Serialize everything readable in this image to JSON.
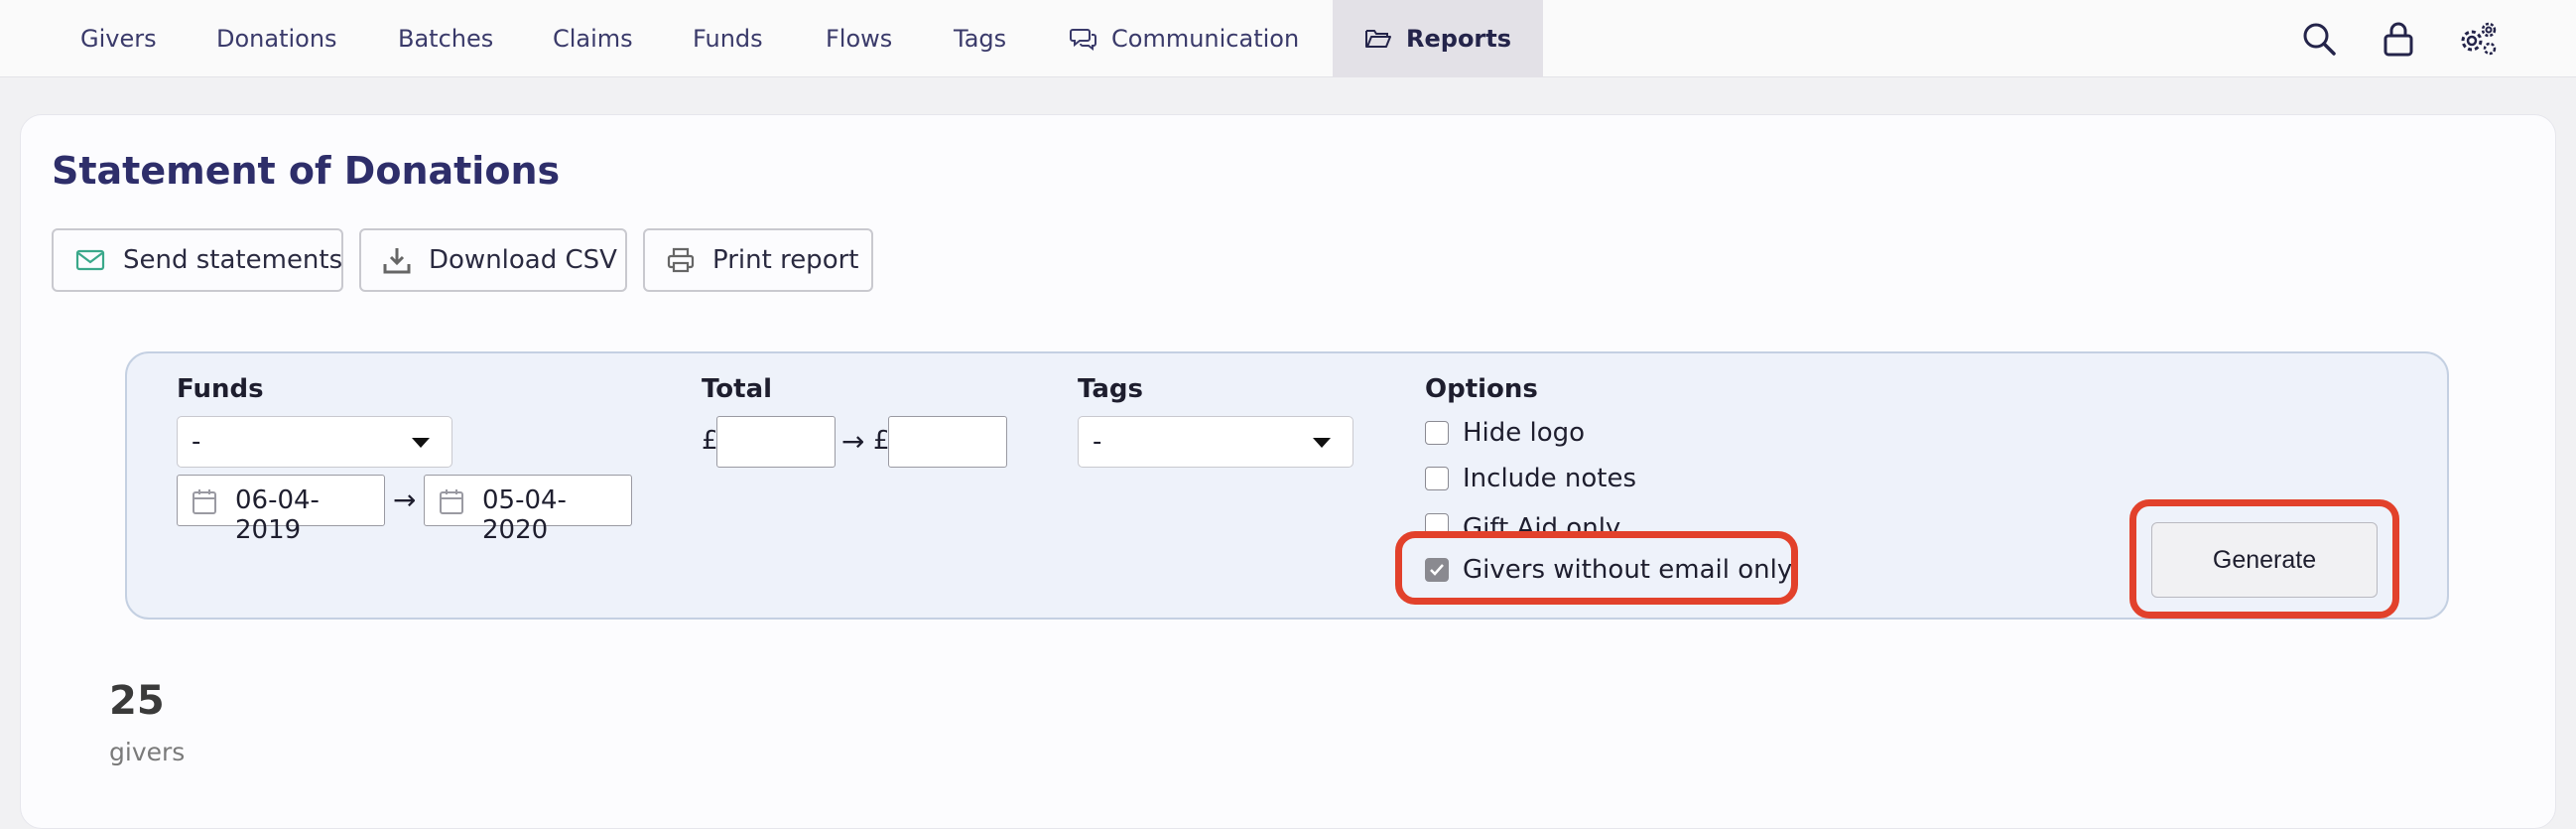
{
  "nav": {
    "items": [
      {
        "label": "Givers"
      },
      {
        "label": "Donations"
      },
      {
        "label": "Batches"
      },
      {
        "label": "Claims"
      },
      {
        "label": "Funds"
      },
      {
        "label": "Flows"
      },
      {
        "label": "Tags"
      },
      {
        "label": "Communication",
        "icon": "chat-bubbles-icon"
      },
      {
        "label": "Reports",
        "icon": "folder-open-icon",
        "active": true
      }
    ],
    "right_icons": [
      "search-icon",
      "lock-icon",
      "settings-gears-icon"
    ]
  },
  "page": {
    "title": "Statement of Donations"
  },
  "toolbar": {
    "send_label": "Send statements",
    "send_icon": "envelope-icon",
    "download_label": "Download CSV",
    "download_icon": "download-icon",
    "print_label": "Print report",
    "print_icon": "printer-icon"
  },
  "filters": {
    "funds": {
      "label": "Funds",
      "selected": "-",
      "date_from": "06-04-2019",
      "date_to": "05-04-2020",
      "arrow": "→"
    },
    "total": {
      "label": "Total",
      "currency": "£",
      "arrow": "→",
      "min_value": "",
      "max_value": ""
    },
    "tags": {
      "label": "Tags",
      "selected": "-"
    },
    "options": {
      "label": "Options",
      "hide_logo": {
        "label": "Hide logo",
        "checked": false
      },
      "include_notes": {
        "label": "Include notes",
        "checked": false
      },
      "gift_aid_only": {
        "label": "Gift Aid only",
        "checked": false
      },
      "givers_without_email": {
        "label": "Givers without email only",
        "checked": true
      }
    },
    "generate_label": "Generate"
  },
  "highlight_color": "#e2412b",
  "accent_color": "#2e2e6a",
  "summary": {
    "count": "25",
    "unit": "givers"
  }
}
